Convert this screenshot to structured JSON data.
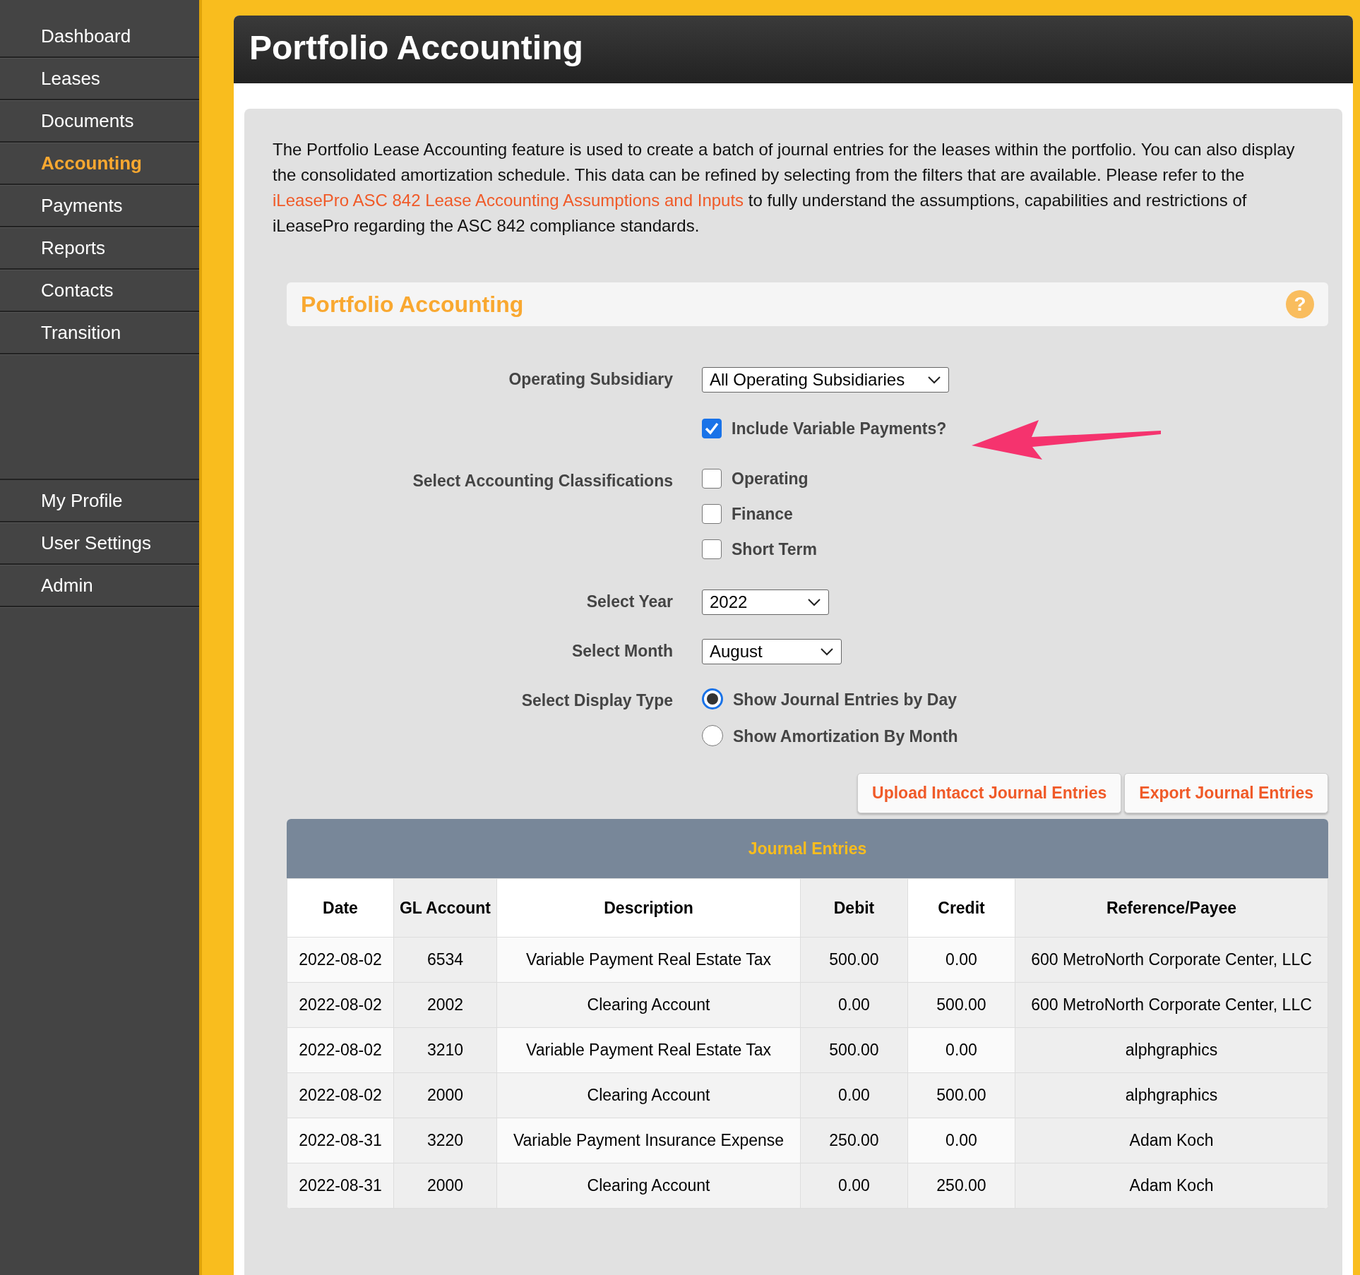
{
  "sidebar": {
    "items": [
      {
        "label": "Dashboard",
        "selected": false
      },
      {
        "label": "Leases",
        "selected": false
      },
      {
        "label": "Documents",
        "selected": false
      },
      {
        "label": "Accounting",
        "selected": true
      },
      {
        "label": "Payments",
        "selected": false
      },
      {
        "label": "Reports",
        "selected": false
      },
      {
        "label": "Contacts",
        "selected": false
      },
      {
        "label": "Transition",
        "selected": false
      }
    ],
    "bottom_items": [
      {
        "label": "My Profile",
        "selected": false
      },
      {
        "label": "User Settings",
        "selected": false
      },
      {
        "label": "Admin",
        "selected": false
      }
    ]
  },
  "page_title": "Portfolio Accounting",
  "description": {
    "before": "The Portfolio Lease Accounting feature is used to create a batch of journal entries for the leases within the portfolio. You can also display the consolidated amortization schedule. This data can be refined by selecting from the filters that are available. Please refer to the ",
    "link": "iLeasePro ASC 842 Lease Accounting Assumptions and Inputs",
    "after": " to fully understand the assumptions, capabilities and restrictions of iLeasePro regarding the ASC 842 compliance standards."
  },
  "section_title": "Portfolio Accounting",
  "help_label": "?",
  "form": {
    "operating_subsidiary": {
      "label": "Operating Subsidiary",
      "value": "All Operating Subsidiaries"
    },
    "include_variable": {
      "label": "Include Variable Payments?",
      "checked": true
    },
    "classifications": {
      "label": "Select Accounting Classifications",
      "options": [
        {
          "label": "Operating",
          "checked": false
        },
        {
          "label": "Finance",
          "checked": false
        },
        {
          "label": "Short Term",
          "checked": false
        }
      ]
    },
    "year": {
      "label": "Select Year",
      "value": "2022"
    },
    "month": {
      "label": "Select Month",
      "value": "August"
    },
    "display_type": {
      "label": "Select Display Type",
      "options": [
        {
          "label": "Show Journal Entries by Day",
          "selected": true
        },
        {
          "label": "Show Amortization By Month",
          "selected": false
        }
      ]
    }
  },
  "buttons": [
    "Upload Intacct Journal Entries",
    "Export Journal Entries"
  ],
  "table": {
    "title": "Journal Entries",
    "columns": [
      "Date",
      "GL Account",
      "Description",
      "Debit",
      "Credit",
      "Reference/Payee"
    ],
    "rows": [
      [
        "2022-08-02",
        "6534",
        "Variable Payment Real Estate Tax",
        "500.00",
        "0.00",
        "600 MetroNorth Corporate Center, LLC"
      ],
      [
        "2022-08-02",
        "2002",
        "Clearing Account",
        "0.00",
        "500.00",
        "600 MetroNorth Corporate Center, LLC"
      ],
      [
        "2022-08-02",
        "3210",
        "Variable Payment Real Estate Tax",
        "500.00",
        "0.00",
        "alphgraphics"
      ],
      [
        "2022-08-02",
        "2000",
        "Clearing Account",
        "0.00",
        "500.00",
        "alphgraphics"
      ],
      [
        "2022-08-31",
        "3220",
        "Variable Payment Insurance Expense",
        "250.00",
        "0.00",
        "Adam Koch"
      ],
      [
        "2022-08-31",
        "2000",
        "Clearing Account",
        "0.00",
        "250.00",
        "Adam Koch"
      ]
    ]
  }
}
